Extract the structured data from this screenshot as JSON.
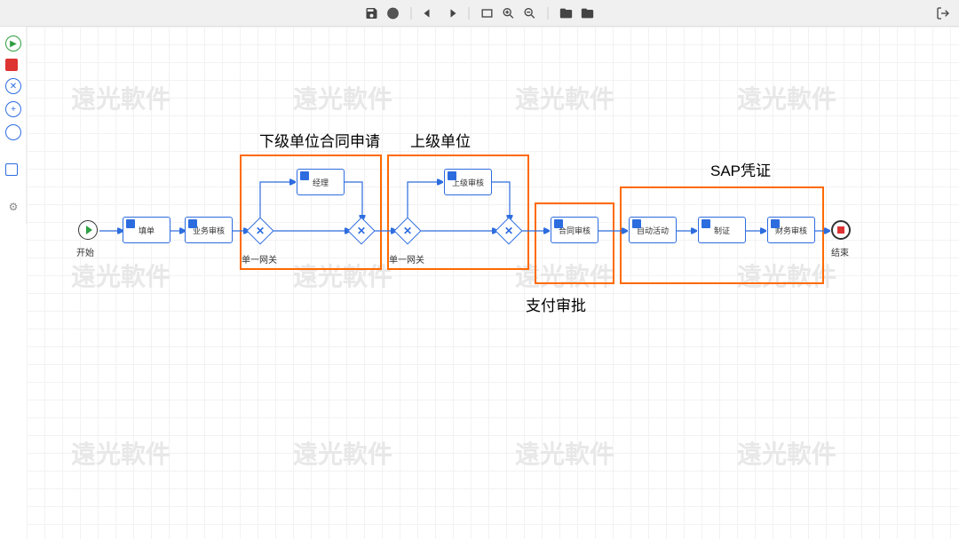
{
  "toolbar": {
    "icons": {
      "save": "save",
      "globe": "globe",
      "undo": "undo",
      "redo": "redo",
      "fit": "fit-to-screen",
      "zoom_in": "zoom-in",
      "zoom_out": "zoom-out",
      "folder_add": "folder-add",
      "folder": "folder",
      "exit": "exit"
    }
  },
  "palette": {
    "items": [
      "start-event",
      "end-event",
      "exclusive-gateway",
      "parallel-gateway",
      "intermediate-event",
      "task",
      "settings"
    ]
  },
  "watermark": "遠光軟件",
  "flow": {
    "start": {
      "label": "开始"
    },
    "end": {
      "label": "结束"
    },
    "tasks": {
      "t1": "填单",
      "t2": "业务审核",
      "t3": "经理",
      "t4": "上级审核",
      "t5": "合同审核",
      "t6": "自动活动",
      "t7": "制证",
      "t8": "财务审核"
    },
    "gateway_label": "单一网关"
  },
  "groups": {
    "g1": {
      "title": "下级单位合同申请"
    },
    "g2": {
      "title": "上级单位"
    },
    "g3": {
      "title": "支付审批"
    },
    "g4": {
      "title": "SAP凭证"
    }
  }
}
